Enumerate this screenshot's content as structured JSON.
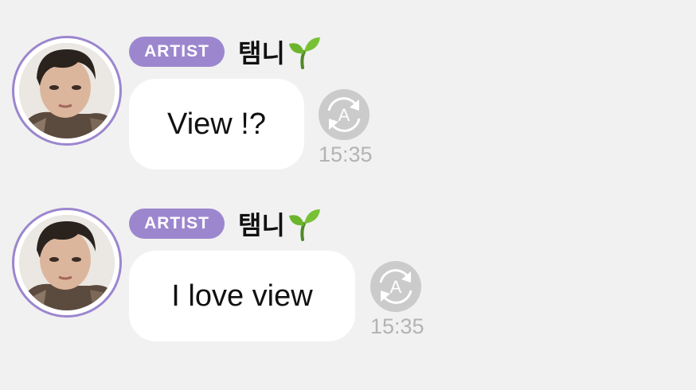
{
  "colors": {
    "background": "#f1f1f1",
    "badge": "#9c87cf",
    "avatar_ring": "#9b86cf",
    "bubble": "#ffffff",
    "timestamp": "#b3b3b3",
    "translate_icon": "#c6c6c6"
  },
  "messages": [
    {
      "badge": "ARTIST",
      "sender": "탬니",
      "sender_emoji_icon": "seedling-icon",
      "text": "View !?",
      "translate_icon": "translate-icon",
      "time": "15:35"
    },
    {
      "badge": "ARTIST",
      "sender": "탬니",
      "sender_emoji_icon": "seedling-icon",
      "text": "I love view",
      "translate_icon": "translate-icon",
      "time": "15:35"
    }
  ]
}
